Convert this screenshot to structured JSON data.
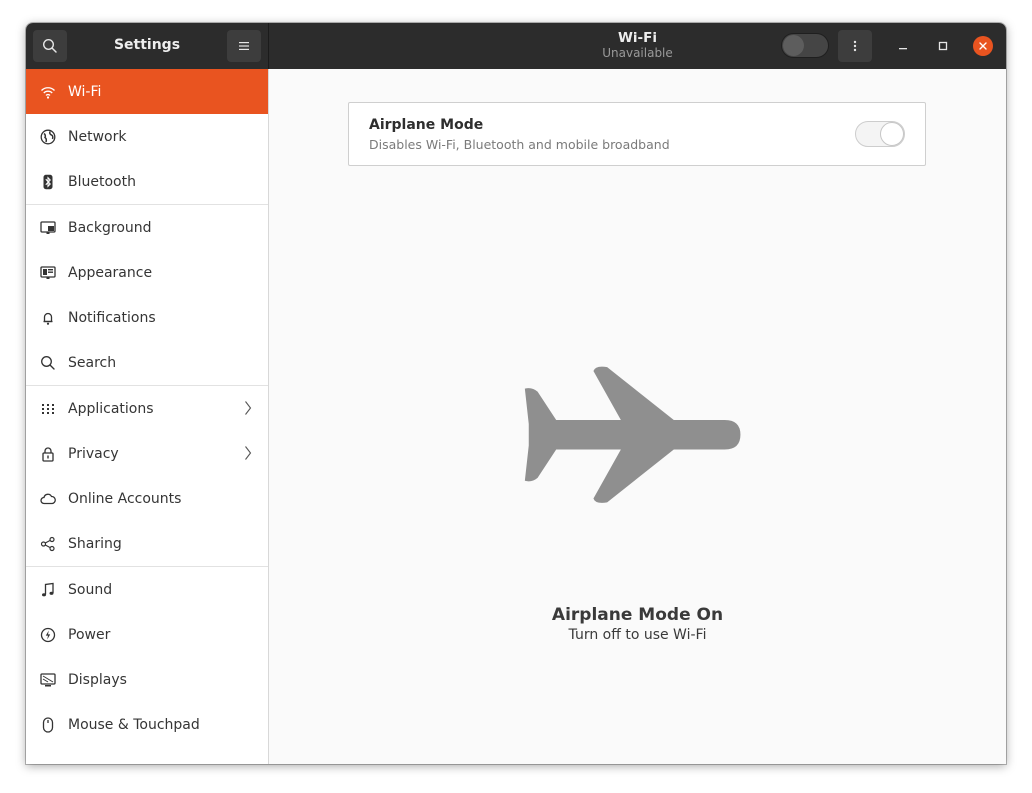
{
  "window": {
    "sidebar_title": "Settings",
    "page_title": "Wi-Fi",
    "page_subtitle": "Unavailable",
    "wifi_toggle_on": false
  },
  "sidebar": {
    "items": [
      {
        "label": "Wi-Fi",
        "icon": "wifi-icon",
        "active": true
      },
      {
        "label": "Network",
        "icon": "network-icon"
      },
      {
        "label": "Bluetooth",
        "icon": "bluetooth-icon"
      },
      {
        "label": "Background",
        "icon": "background-icon"
      },
      {
        "label": "Appearance",
        "icon": "appearance-icon"
      },
      {
        "label": "Notifications",
        "icon": "bell-icon"
      },
      {
        "label": "Search",
        "icon": "search-icon"
      },
      {
        "label": "Applications",
        "icon": "grid-icon",
        "has_submenu": true
      },
      {
        "label": "Privacy",
        "icon": "lock-icon",
        "has_submenu": true
      },
      {
        "label": "Online Accounts",
        "icon": "cloud-icon"
      },
      {
        "label": "Sharing",
        "icon": "share-icon"
      },
      {
        "label": "Sound",
        "icon": "music-note-icon"
      },
      {
        "label": "Power",
        "icon": "power-icon"
      },
      {
        "label": "Displays",
        "icon": "display-icon"
      },
      {
        "label": "Mouse & Touchpad",
        "icon": "mouse-icon"
      }
    ]
  },
  "airplane_card": {
    "title": "Airplane Mode",
    "description": "Disables Wi-Fi, Bluetooth and mobile broadband",
    "enabled": true
  },
  "status": {
    "icon": "airplane-icon",
    "title": "Airplane Mode On",
    "subtitle": "Turn off to use Wi-Fi"
  },
  "colors": {
    "accent": "#e95420",
    "headerbar": "#2c2c2c",
    "sidebar_bg": "#ffffff",
    "content_bg": "#fafafa",
    "airplane_icon": "#8f8f8f"
  }
}
